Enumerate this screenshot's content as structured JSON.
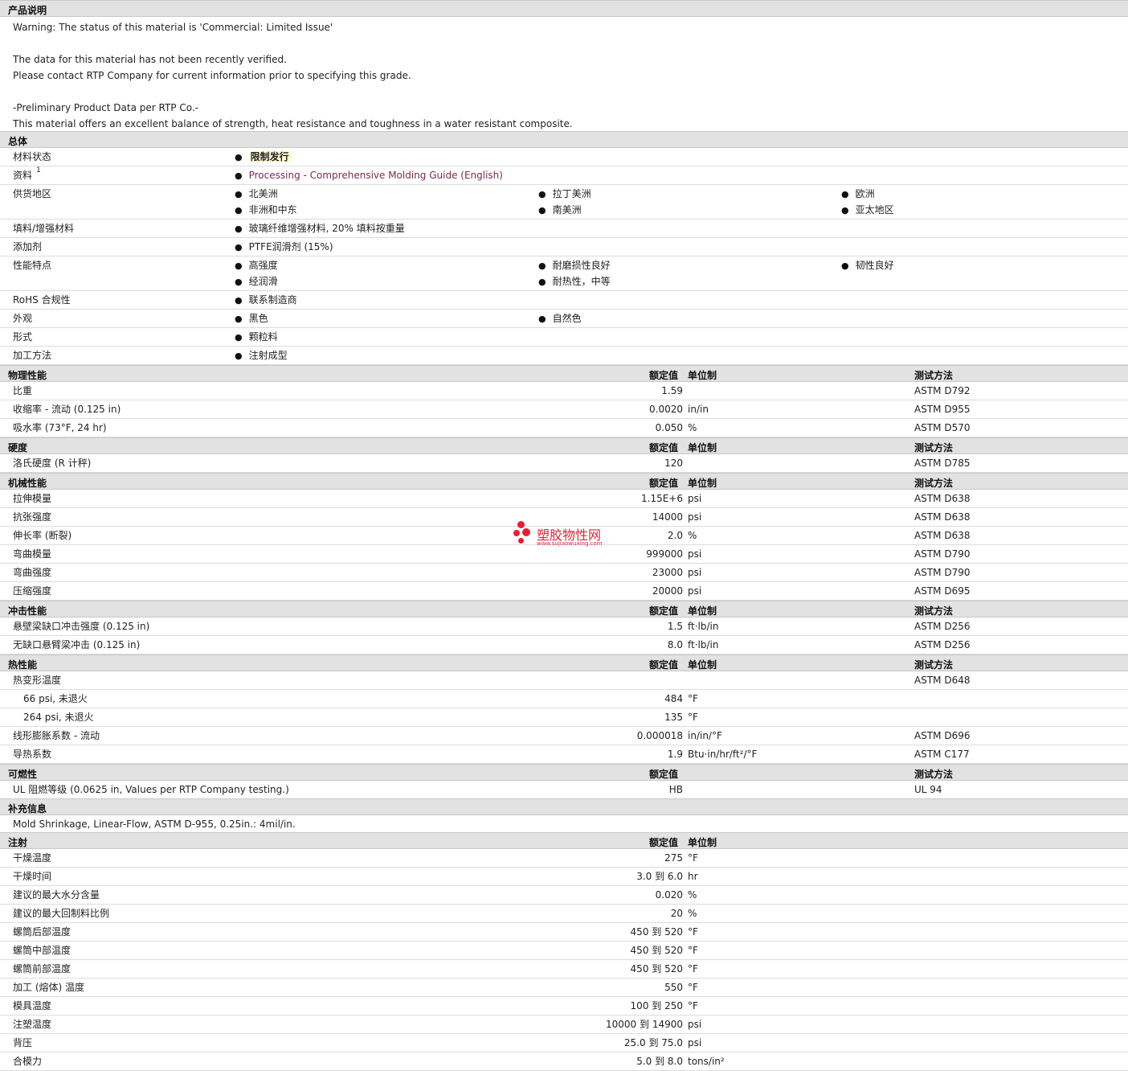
{
  "description": {
    "title": "产品说明",
    "lines": [
      "Warning: The status of this material is 'Commercial: Limited Issue'",
      "",
      "The data for this material has not been recently verified.",
      "Please contact RTP Company for current information prior to specifying this grade.",
      "",
      "-Preliminary Product Data per RTP Co.-",
      "This material offers an excellent balance of strength, heat resistance and toughness in a water resistant composite."
    ]
  },
  "general": {
    "title": "总体",
    "rows": [
      {
        "label": "材料状态",
        "values": [
          "限制发行"
        ],
        "highlight": true
      },
      {
        "label": "资料",
        "sup": "1",
        "values": [
          "Processing - Comprehensive Molding Guide (English)"
        ],
        "link": true
      },
      {
        "label": "供货地区",
        "values": [
          "北美洲",
          "拉丁美洲",
          "欧洲",
          "非洲和中东",
          "南美洲",
          "亚太地区"
        ]
      },
      {
        "label": "填料/增强材料",
        "values": [
          "玻璃纤维增强材料, 20% 填料按重量"
        ]
      },
      {
        "label": "添加剂",
        "values": [
          "PTFE润滑剂 (15%)"
        ]
      },
      {
        "label": "性能特点",
        "values": [
          "高强度",
          "耐磨损性良好",
          "韧性良好",
          "经润滑",
          "耐热性，中等"
        ]
      },
      {
        "label": "RoHS 合规性",
        "values": [
          "联系制造商"
        ]
      },
      {
        "label": "外观",
        "values": [
          "黑色",
          "自然色"
        ]
      },
      {
        "label": "形式",
        "values": [
          "颗粒料"
        ]
      },
      {
        "label": "加工方法",
        "values": [
          "注射成型"
        ]
      }
    ]
  },
  "headers": {
    "nominal": "额定值",
    "unit": "单位制",
    "method": "测试方法"
  },
  "sections": [
    {
      "title": "物理性能",
      "rows": [
        {
          "label": "比重",
          "value": "1.59",
          "unit": "",
          "method": "ASTM D792"
        },
        {
          "label": "收缩率  - 流动 (0.125 in)",
          "value": "0.0020",
          "unit": "in/in",
          "method": "ASTM D955"
        },
        {
          "label": "吸水率 (73°F, 24 hr)",
          "value": "0.050",
          "unit": "%",
          "method": "ASTM D570"
        }
      ]
    },
    {
      "title": "硬度",
      "rows": [
        {
          "label": "洛氏硬度 (R 计秤)",
          "value": "120",
          "unit": "",
          "method": "ASTM D785"
        }
      ]
    },
    {
      "title": "机械性能",
      "rows": [
        {
          "label": "拉伸模量",
          "value": "1.15E+6",
          "unit": "psi",
          "method": "ASTM D638"
        },
        {
          "label": "抗张强度",
          "value": "14000",
          "unit": "psi",
          "method": "ASTM D638"
        },
        {
          "label": "伸长率 (断裂)",
          "value": "2.0",
          "unit": "%",
          "method": "ASTM D638"
        },
        {
          "label": "弯曲模量",
          "value": "999000",
          "unit": "psi",
          "method": "ASTM D790"
        },
        {
          "label": "弯曲强度",
          "value": "23000",
          "unit": "psi",
          "method": "ASTM D790"
        },
        {
          "label": "压缩强度",
          "value": "20000",
          "unit": "psi",
          "method": "ASTM D695"
        }
      ]
    },
    {
      "title": "冲击性能",
      "rows": [
        {
          "label": "悬壁梁缺口冲击强度 (0.125 in)",
          "value": "1.5",
          "unit": "ft·lb/in",
          "method": "ASTM D256"
        },
        {
          "label": "无缺口悬臂梁冲击 (0.125 in)",
          "value": "8.0",
          "unit": "ft·lb/in",
          "method": "ASTM D256"
        }
      ]
    },
    {
      "title": "热性能",
      "rows": [
        {
          "label": "热变形温度",
          "value": "",
          "unit": "",
          "method": "ASTM D648"
        },
        {
          "label": "66 psi, 未退火",
          "value": "484",
          "unit": "°F",
          "method": "",
          "indent": true
        },
        {
          "label": "264 psi, 未退火",
          "value": "135",
          "unit": "°F",
          "method": "",
          "indent": true
        },
        {
          "label": "线形膨胀系数  - 流动",
          "value": "0.000018",
          "unit": "in/in/°F",
          "method": "ASTM D696"
        },
        {
          "label": "导热系数",
          "value": "1.9",
          "unit": "Btu·in/hr/ft²/°F",
          "method": "ASTM C177"
        }
      ]
    },
    {
      "title": "可燃性",
      "noUnitHeader": true,
      "rows": [
        {
          "label": "UL 阻燃等级 (0.0625 in, Values per RTP Company testing.)",
          "value": "HB",
          "unit": "",
          "method": "UL 94"
        }
      ]
    }
  ],
  "supplement": {
    "title": "补充信息",
    "text": "Mold Shrinkage, Linear-Flow, ASTM D-955, 0.25in.: 4mil/in."
  },
  "injection": {
    "title": "注射",
    "rows": [
      {
        "label": "干燥温度",
        "value": "275",
        "unit": "°F"
      },
      {
        "label": "干燥时间",
        "value": "3.0 到  6.0",
        "unit": "hr"
      },
      {
        "label": "建议的最大水分含量",
        "value": "0.020",
        "unit": "%"
      },
      {
        "label": "建议的最大回制料比例",
        "value": "20",
        "unit": "%"
      },
      {
        "label": "螺筒后部温度",
        "value": "450 到  520",
        "unit": "°F"
      },
      {
        "label": "螺筒中部温度",
        "value": "450 到  520",
        "unit": "°F"
      },
      {
        "label": "螺筒前部温度",
        "value": "450 到  520",
        "unit": "°F"
      },
      {
        "label": "加工 (熔体) 温度",
        "value": "550",
        "unit": "°F"
      },
      {
        "label": "模具温度",
        "value": "100 到  250",
        "unit": "°F"
      },
      {
        "label": "注塑温度",
        "value": "10000 到  14900",
        "unit": "psi"
      },
      {
        "label": "背压",
        "value": "25.0 到  75.0",
        "unit": "psi"
      },
      {
        "label": "合模力",
        "value": "5.0 到  8.0",
        "unit": "tons/in²"
      }
    ]
  },
  "watermark": {
    "text": "塑胶物性网",
    "sub": "www.sujiaowuxing.com"
  }
}
